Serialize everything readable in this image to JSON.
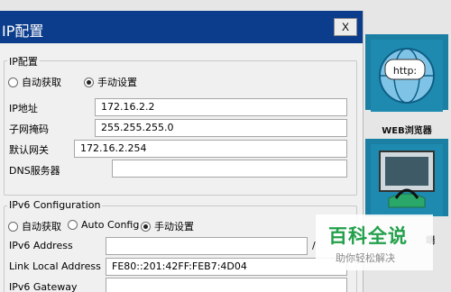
{
  "window": {
    "title": "IP配置",
    "close_label": "X",
    "top_strip_fragment": "\"\""
  },
  "ipv4": {
    "legend": "IP配置",
    "mode_options": [
      "自动获取",
      "手动设置"
    ],
    "selected_mode": "手动设置",
    "ip_label": "IP地址",
    "ip_value": "172.16.2.2",
    "mask_label": "子网掩码",
    "mask_value": "255.255.255.0",
    "gateway_label": "默认网关",
    "gateway_value": "172.16.2.254",
    "dns_label": "DNS服务器",
    "dns_value": ""
  },
  "ipv6": {
    "legend": "IPv6 Configuration",
    "mode_options": [
      "自动获取",
      "Auto Config",
      "手动设置"
    ],
    "selected_mode": "手动设置",
    "address_label": "IPv6 Address",
    "address_value": "",
    "address_suffix": "/",
    "link_local_label": "Link Local Address",
    "link_local_value": "FE80::201:42FF:FEB7:4D04",
    "gateway_label": "IPv6 Gateway",
    "gateway_value": ""
  },
  "right_pane": {
    "web_browser_label": "WEB浏览器",
    "http_bubble": "http:",
    "terminal_label_fragment": "端"
  },
  "watermark": {
    "big": "百科全说",
    "small": "助你轻松解决"
  },
  "colors": {
    "titlebar": "#0b3d8c",
    "card": "#1a7fa3",
    "watermark": "#22a04a"
  }
}
